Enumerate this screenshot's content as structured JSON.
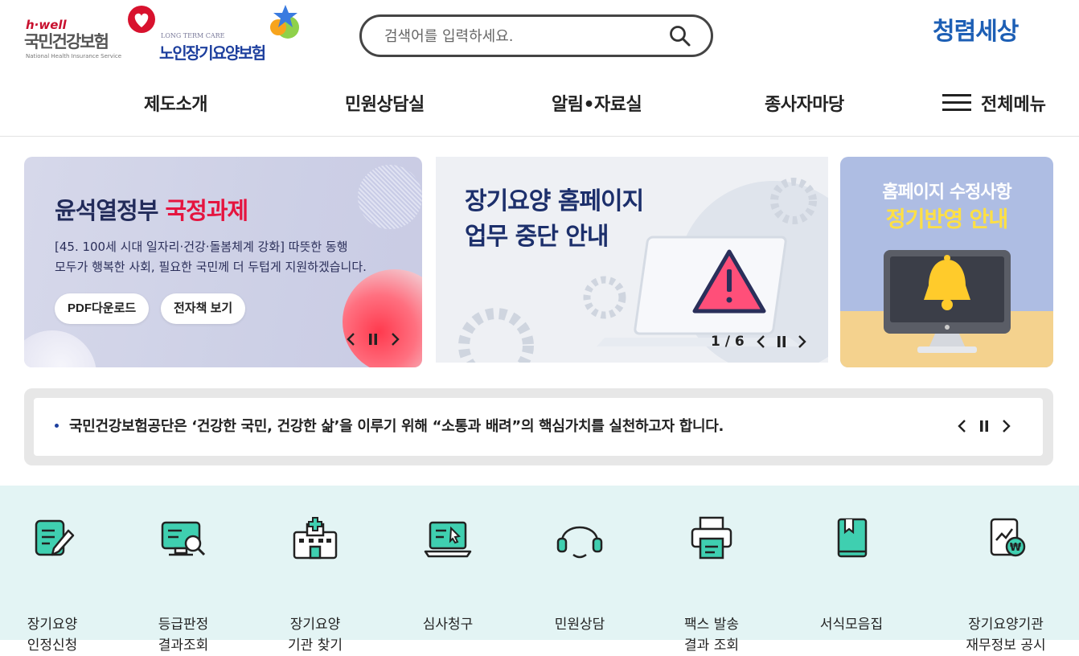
{
  "header": {
    "logo_nhis": {
      "hwell": "h·well",
      "name": "국민건강보험",
      "sub": "National Health Insurance Service"
    },
    "logo_ltc": {
      "caption": "LONG TERM CARE",
      "name": "노인장기요양보험"
    },
    "logo_clean": {
      "text": "청렴세상"
    },
    "search": {
      "placeholder": "검색어를 입력하세요."
    }
  },
  "nav": {
    "items": [
      "제도소개",
      "민원상담실",
      "알림•자료실",
      "종사자마당"
    ],
    "all_menu_label": "전체메뉴"
  },
  "banners": {
    "left": {
      "title_plain": "윤석열정부 ",
      "title_accent": "국정과제",
      "desc_line1": "[45. 100세 시대 일자리·건강·돌봄체계 강화] 따뜻한 동행",
      "desc_line2": "모두가 행복한 사회, 필요한 국민께 더 두텁게 지원하겠습니다.",
      "btn_pdf": "PDF다운로드",
      "btn_ebook": "전자책 보기"
    },
    "center": {
      "line1": "장기요양 홈페이지",
      "line2": "업무 중단 안내",
      "page_current": "1",
      "page_sep": "/",
      "page_total": "6"
    },
    "right": {
      "line1": "홈페이지 수정사항",
      "line2": "정기반영 안내"
    }
  },
  "notice": {
    "text": "국민건강보험공단은 ‘건강한 국민, 건강한 삶’을 이루기 위해 “소통과 배려”의 핵심가치를 실천하고자 합니다."
  },
  "quick_menu": [
    {
      "label": "장기요양\n인정신청",
      "icon": "application-form-icon"
    },
    {
      "label": "등급판정\n결과조회",
      "icon": "monitor-search-icon"
    },
    {
      "label": "장기요양\n기관 찾기",
      "icon": "hospital-building-icon"
    },
    {
      "label": "심사청구",
      "icon": "laptop-click-icon"
    },
    {
      "label": "민원상담",
      "icon": "headset-icon"
    },
    {
      "label": "팩스 발송\n결과 조회",
      "icon": "fax-printer-icon"
    },
    {
      "label": "서식모음집",
      "icon": "book-icon"
    },
    {
      "label": "장기요양기관\n재무정보 공시",
      "icon": "financial-report-icon"
    }
  ],
  "colors": {
    "accent_teal": "#3fcfb0",
    "brand_blue": "#1d3f9e",
    "accent_red": "#e5143f",
    "quick_bg": "#e3f4f4"
  }
}
